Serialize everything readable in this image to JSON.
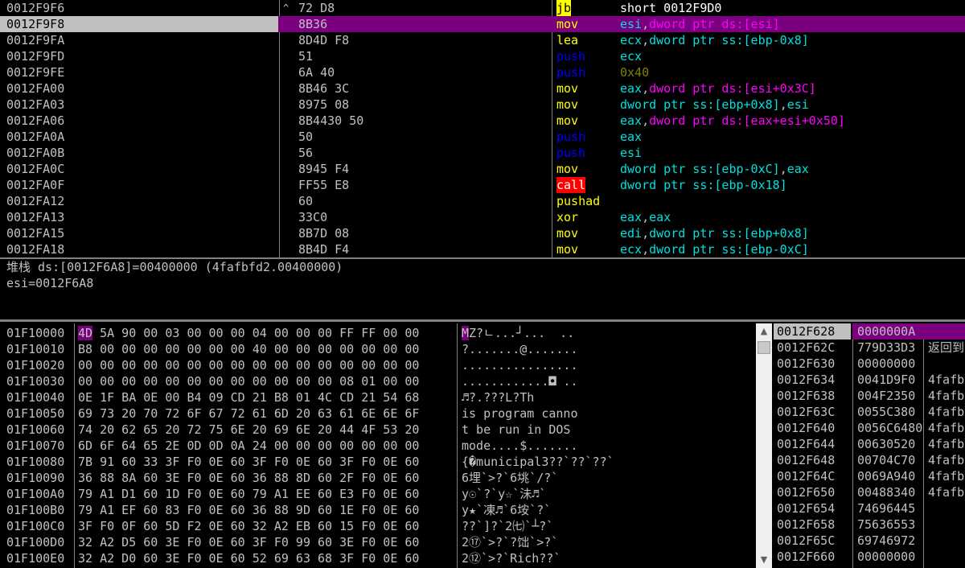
{
  "colors": {
    "selection": "#7b0080",
    "text": "#c0c0c0",
    "mnemonic_default": "#ff00ff",
    "mnemonic_push": "#0000ff",
    "mnemonic_jump": "#ffff00",
    "mnemonic_call": "#ffffff",
    "mnemonic_normal": "#ffff00",
    "operand_cyan": "#00e0e0",
    "operand_magenta": "#ff00ff",
    "immediate": "#808000"
  },
  "disasm": {
    "rows": [
      {
        "addr": "0012F9F6",
        "jmark": "^",
        "hex": "72 D8",
        "mn": "jb",
        "mnStyle": "jump",
        "ops": [
          {
            "t": "short 0012F9D0",
            "c": "#ffffff"
          }
        ]
      },
      {
        "addr": "0012F9F8",
        "jmark": "",
        "hex": "8B36",
        "mn": "mov",
        "mnStyle": "mov",
        "ops": [
          {
            "t": "esi",
            "c": "#00e0e0"
          },
          {
            "t": ",",
            "c": "#c0c0c0"
          },
          {
            "t": "dword ptr ds:[esi]",
            "c": "#ff00ff"
          }
        ],
        "selected": true
      },
      {
        "addr": "0012F9FA",
        "jmark": "",
        "hex": "8D4D F8",
        "mn": "lea",
        "mnStyle": "normal",
        "ops": [
          {
            "t": "ecx",
            "c": "#00e0e0"
          },
          {
            "t": ",",
            "c": "#c0c0c0"
          },
          {
            "t": "dword ptr ss:[ebp-0x8]",
            "c": "#00e0e0"
          }
        ]
      },
      {
        "addr": "0012F9FD",
        "jmark": "",
        "hex": "51",
        "mn": "push",
        "mnStyle": "push",
        "ops": [
          {
            "t": "ecx",
            "c": "#00e0e0"
          }
        ]
      },
      {
        "addr": "0012F9FE",
        "jmark": "",
        "hex": "6A 40",
        "mn": "push",
        "mnStyle": "push",
        "ops": [
          {
            "t": "0x40",
            "c": "#808000"
          }
        ]
      },
      {
        "addr": "0012FA00",
        "jmark": "",
        "hex": "8B46 3C",
        "mn": "mov",
        "mnStyle": "normal",
        "ops": [
          {
            "t": "eax",
            "c": "#00e0e0"
          },
          {
            "t": ",",
            "c": "#c0c0c0"
          },
          {
            "t": "dword ptr ds:[esi+0x3C]",
            "c": "#ff00ff"
          }
        ]
      },
      {
        "addr": "0012FA03",
        "jmark": "",
        "hex": "8975 08",
        "mn": "mov",
        "mnStyle": "normal",
        "ops": [
          {
            "t": "dword ptr ss:[ebp+0x8]",
            "c": "#00e0e0"
          },
          {
            "t": ",",
            "c": "#c0c0c0"
          },
          {
            "t": "esi",
            "c": "#00e0e0"
          }
        ]
      },
      {
        "addr": "0012FA06",
        "jmark": "",
        "hex": "8B4430 50",
        "mn": "mov",
        "mnStyle": "normal",
        "ops": [
          {
            "t": "eax",
            "c": "#00e0e0"
          },
          {
            "t": ",",
            "c": "#c0c0c0"
          },
          {
            "t": "dword ptr ds:[eax+esi+0x50]",
            "c": "#ff00ff"
          }
        ]
      },
      {
        "addr": "0012FA0A",
        "jmark": "",
        "hex": "50",
        "mn": "push",
        "mnStyle": "push",
        "ops": [
          {
            "t": "eax",
            "c": "#00e0e0"
          }
        ]
      },
      {
        "addr": "0012FA0B",
        "jmark": "",
        "hex": "56",
        "mn": "push",
        "mnStyle": "push",
        "ops": [
          {
            "t": "esi",
            "c": "#00e0e0"
          }
        ]
      },
      {
        "addr": "0012FA0C",
        "jmark": "",
        "hex": "8945 F4",
        "mn": "mov",
        "mnStyle": "normal",
        "ops": [
          {
            "t": "dword ptr ss:[ebp-0xC]",
            "c": "#00e0e0"
          },
          {
            "t": ",",
            "c": "#c0c0c0"
          },
          {
            "t": "eax",
            "c": "#00e0e0"
          }
        ]
      },
      {
        "addr": "0012FA0F",
        "jmark": "",
        "hex": "FF55 E8",
        "mn": "call",
        "mnStyle": "call",
        "ops": [
          {
            "t": "dword ptr ss:[ebp-0x18]",
            "c": "#00e0e0"
          }
        ]
      },
      {
        "addr": "0012FA12",
        "jmark": "",
        "hex": "60",
        "mn": "pushad",
        "mnStyle": "normal",
        "ops": []
      },
      {
        "addr": "0012FA13",
        "jmark": "",
        "hex": "33C0",
        "mn": "xor",
        "mnStyle": "normal",
        "ops": [
          {
            "t": "eax",
            "c": "#00e0e0"
          },
          {
            "t": ",",
            "c": "#c0c0c0"
          },
          {
            "t": "eax",
            "c": "#00e0e0"
          }
        ]
      },
      {
        "addr": "0012FA15",
        "jmark": "",
        "hex": "8B7D 08",
        "mn": "mov",
        "mnStyle": "normal",
        "ops": [
          {
            "t": "edi",
            "c": "#00e0e0"
          },
          {
            "t": ",",
            "c": "#c0c0c0"
          },
          {
            "t": "dword ptr ss:[ebp+0x8]",
            "c": "#00e0e0"
          }
        ]
      },
      {
        "addr": "0012FA18",
        "jmark": "",
        "hex": "8B4D F4",
        "mn": "mov",
        "mnStyle": "normal",
        "ops": [
          {
            "t": "ecx",
            "c": "#00e0e0"
          },
          {
            "t": ",",
            "c": "#c0c0c0"
          },
          {
            "t": "dword ptr ss:[ebp-0xC]",
            "c": "#00e0e0"
          }
        ]
      }
    ]
  },
  "info": {
    "line1": "堆栈 ds:[0012F6A8]=00400000 (4fafbfd2.00400000)",
    "line2": "esi=0012F6A8"
  },
  "dump": {
    "rows": [
      {
        "addr": "01F10000",
        "hex": [
          "4D 5A 90 00",
          "03 00 00 00",
          "04 00 00 00",
          "FF FF 00 00"
        ],
        "ascii": "MZ?ㄴ...┘...  ..",
        "hlFirst": true
      },
      {
        "addr": "01F10010",
        "hex": [
          "B8 00 00 00",
          "00 00 00 00",
          "40 00 00 00",
          "00 00 00 00"
        ],
        "ascii": "?.......@......."
      },
      {
        "addr": "01F10020",
        "hex": [
          "00 00 00 00",
          "00 00 00 00",
          "00 00 00 00",
          "00 00 00 00"
        ],
        "ascii": "................"
      },
      {
        "addr": "01F10030",
        "hex": [
          "00 00 00 00",
          "00 00 00 00",
          "00 00 00 00",
          "08 01 00 00"
        ],
        "ascii": "............◘ .."
      },
      {
        "addr": "01F10040",
        "hex": [
          "0E 1F BA 0E",
          "00 B4 09 CD",
          "21 B8 01 4C",
          "CD 21 54 68"
        ],
        "ascii": "♬?.???L?Th"
      },
      {
        "addr": "01F10050",
        "hex": [
          "69 73 20 70",
          "72 6F 67 72",
          "61 6D 20 63",
          "61 6E 6E 6F"
        ],
        "ascii": "is program canno"
      },
      {
        "addr": "01F10060",
        "hex": [
          "74 20 62 65",
          "20 72 75 6E",
          "20 69 6E 20",
          "44 4F 53 20"
        ],
        "ascii": "t be run in DOS "
      },
      {
        "addr": "01F10070",
        "hex": [
          "6D 6F 64 65",
          "2E 0D 0D 0A",
          "24 00 00 00",
          "00 00 00 00"
        ],
        "ascii": "mode....$......."
      },
      {
        "addr": "01F10080",
        "hex": [
          "7B 91 60 33",
          "3F F0 0E 60",
          "3F F0 0E 60",
          "3F F0 0E 60"
        ],
        "ascii": "{�municipal3??`??`??`"
      },
      {
        "addr": "01F10090",
        "hex": [
          "36 88 8A 60",
          "3E F0 0E 60",
          "36 88 8D 60",
          "2F F0 0E 60"
        ],
        "ascii": "6埋`>?`6垗`/?`"
      },
      {
        "addr": "01F100A0",
        "hex": [
          "79 A1 D1 60",
          "1D F0 0E 60",
          "79 A1 EE 60",
          "E3 F0 0E 60"
        ],
        "ascii": "y☉`?`y☆`沬♬`"
      },
      {
        "addr": "01F100B0",
        "hex": [
          "79 A1 EF 60",
          "83 F0 0E 60",
          "36 88 9D 60",
          "1E F0 0E 60"
        ],
        "ascii": "y★`凍♬`6垵`?`"
      },
      {
        "addr": "01F100C0",
        "hex": [
          "3F F0 0F 60",
          "5D F2 0E 60",
          "32 A2 EB 60",
          "15 F0 0E 60"
        ],
        "ascii": "??`]?`2㈦`┴?`"
      },
      {
        "addr": "01F100D0",
        "hex": [
          "32 A2 D5 60",
          "3E F0 0E 60",
          "3F F0 99 60",
          "3E F0 0E 60"
        ],
        "ascii": "2⑰`>?`?饳`>?`"
      },
      {
        "addr": "01F100E0",
        "hex": [
          "32 A2 D0 60",
          "3E F0 0E 60",
          "52 69 63 68",
          "3F F0 0E 60"
        ],
        "ascii": "2⑫`>?`Rich??`"
      }
    ]
  },
  "stack": {
    "rows": [
      {
        "addr": "0012F628",
        "val": "0000000A",
        "com": "",
        "top": true
      },
      {
        "addr": "0012F62C",
        "val": "779D33D3",
        "com": "返回到"
      },
      {
        "addr": "0012F630",
        "val": "00000000",
        "com": ""
      },
      {
        "addr": "0012F634",
        "val": "0041D9F0",
        "com": "4fafb"
      },
      {
        "addr": "0012F638",
        "val": "004F2350",
        "com": "4fafb"
      },
      {
        "addr": "0012F63C",
        "val": "0055C380",
        "com": "4fafb"
      },
      {
        "addr": "0012F640",
        "val": "0056C6480",
        "com": "4fafb"
      },
      {
        "addr": "0012F644",
        "val": "00630520",
        "com": "4fafb"
      },
      {
        "addr": "0012F648",
        "val": "00704C70",
        "com": "4fafb"
      },
      {
        "addr": "0012F64C",
        "val": "0069A940",
        "com": "4fafb"
      },
      {
        "addr": "0012F650",
        "val": "00488340",
        "com": "4fafb"
      },
      {
        "addr": "0012F654",
        "val": "74696445",
        "com": ""
      },
      {
        "addr": "0012F658",
        "val": "75636553",
        "com": ""
      },
      {
        "addr": "0012F65C",
        "val": "69746972",
        "com": ""
      },
      {
        "addr": "0012F660",
        "val": "00000000",
        "com": ""
      }
    ]
  },
  "scrollbar": {
    "up_icon": "▲",
    "down_icon": "▼",
    "grip_icon": "≡"
  }
}
